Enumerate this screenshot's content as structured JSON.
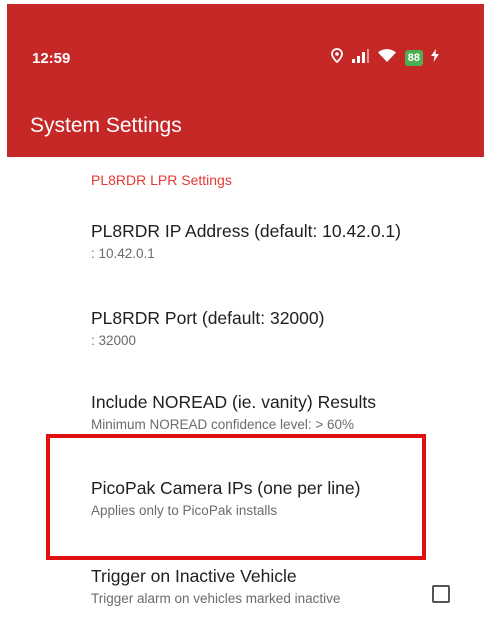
{
  "status_bar": {
    "time": "12:59",
    "battery": "88"
  },
  "app_bar": {
    "title": "System Settings"
  },
  "section": {
    "title": "PL8RDR LPR Settings"
  },
  "items": [
    {
      "title": "PL8RDR IP Address (default: 10.42.0.1)",
      "summary": ": 10.42.0.1"
    },
    {
      "title": "PL8RDR Port (default: 32000)",
      "summary": ": 32000"
    },
    {
      "title": "Include NOREAD (ie. vanity) Results",
      "summary": "Minimum NOREAD confidence level: > 60%"
    },
    {
      "title": "PicoPak Camera IPs (one per line)",
      "summary": "Applies only to PicoPak installs"
    },
    {
      "title": "Trigger on Inactive Vehicle",
      "summary": "Trigger alarm on vehicles marked inactive",
      "checked": false
    }
  ],
  "colors": {
    "app_bar": "#c62828",
    "section_header": "#e53935",
    "battery": "#4caf50",
    "highlight": "#e01010"
  },
  "icons": [
    "location-icon",
    "signal-icon",
    "wifi-icon",
    "charging-icon"
  ]
}
